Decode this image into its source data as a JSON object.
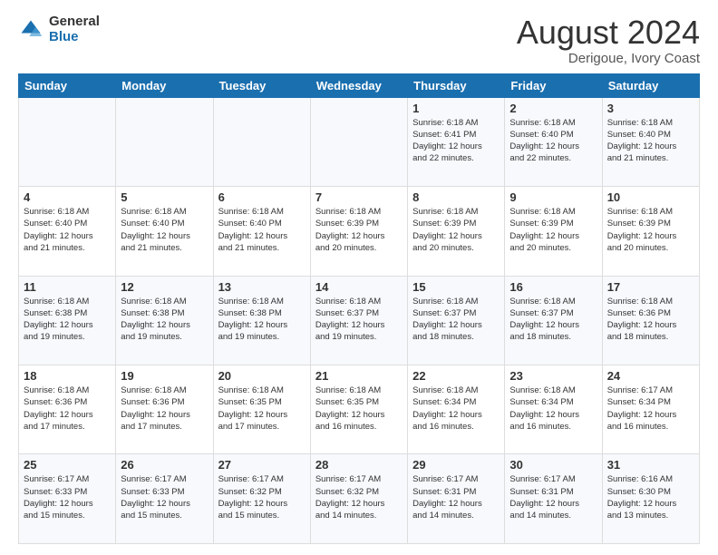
{
  "logo": {
    "general": "General",
    "blue": "Blue"
  },
  "header": {
    "title": "August 2024",
    "subtitle": "Derigoue, Ivory Coast"
  },
  "weekdays": [
    "Sunday",
    "Monday",
    "Tuesday",
    "Wednesday",
    "Thursday",
    "Friday",
    "Saturday"
  ],
  "weeks": [
    [
      {
        "day": "",
        "detail": ""
      },
      {
        "day": "",
        "detail": ""
      },
      {
        "day": "",
        "detail": ""
      },
      {
        "day": "",
        "detail": ""
      },
      {
        "day": "1",
        "detail": "Sunrise: 6:18 AM\nSunset: 6:41 PM\nDaylight: 12 hours\nand 22 minutes."
      },
      {
        "day": "2",
        "detail": "Sunrise: 6:18 AM\nSunset: 6:40 PM\nDaylight: 12 hours\nand 22 minutes."
      },
      {
        "day": "3",
        "detail": "Sunrise: 6:18 AM\nSunset: 6:40 PM\nDaylight: 12 hours\nand 21 minutes."
      }
    ],
    [
      {
        "day": "4",
        "detail": "Sunrise: 6:18 AM\nSunset: 6:40 PM\nDaylight: 12 hours\nand 21 minutes."
      },
      {
        "day": "5",
        "detail": "Sunrise: 6:18 AM\nSunset: 6:40 PM\nDaylight: 12 hours\nand 21 minutes."
      },
      {
        "day": "6",
        "detail": "Sunrise: 6:18 AM\nSunset: 6:40 PM\nDaylight: 12 hours\nand 21 minutes."
      },
      {
        "day": "7",
        "detail": "Sunrise: 6:18 AM\nSunset: 6:39 PM\nDaylight: 12 hours\nand 20 minutes."
      },
      {
        "day": "8",
        "detail": "Sunrise: 6:18 AM\nSunset: 6:39 PM\nDaylight: 12 hours\nand 20 minutes."
      },
      {
        "day": "9",
        "detail": "Sunrise: 6:18 AM\nSunset: 6:39 PM\nDaylight: 12 hours\nand 20 minutes."
      },
      {
        "day": "10",
        "detail": "Sunrise: 6:18 AM\nSunset: 6:39 PM\nDaylight: 12 hours\nand 20 minutes."
      }
    ],
    [
      {
        "day": "11",
        "detail": "Sunrise: 6:18 AM\nSunset: 6:38 PM\nDaylight: 12 hours\nand 19 minutes."
      },
      {
        "day": "12",
        "detail": "Sunrise: 6:18 AM\nSunset: 6:38 PM\nDaylight: 12 hours\nand 19 minutes."
      },
      {
        "day": "13",
        "detail": "Sunrise: 6:18 AM\nSunset: 6:38 PM\nDaylight: 12 hours\nand 19 minutes."
      },
      {
        "day": "14",
        "detail": "Sunrise: 6:18 AM\nSunset: 6:37 PM\nDaylight: 12 hours\nand 19 minutes."
      },
      {
        "day": "15",
        "detail": "Sunrise: 6:18 AM\nSunset: 6:37 PM\nDaylight: 12 hours\nand 18 minutes."
      },
      {
        "day": "16",
        "detail": "Sunrise: 6:18 AM\nSunset: 6:37 PM\nDaylight: 12 hours\nand 18 minutes."
      },
      {
        "day": "17",
        "detail": "Sunrise: 6:18 AM\nSunset: 6:36 PM\nDaylight: 12 hours\nand 18 minutes."
      }
    ],
    [
      {
        "day": "18",
        "detail": "Sunrise: 6:18 AM\nSunset: 6:36 PM\nDaylight: 12 hours\nand 17 minutes."
      },
      {
        "day": "19",
        "detail": "Sunrise: 6:18 AM\nSunset: 6:36 PM\nDaylight: 12 hours\nand 17 minutes."
      },
      {
        "day": "20",
        "detail": "Sunrise: 6:18 AM\nSunset: 6:35 PM\nDaylight: 12 hours\nand 17 minutes."
      },
      {
        "day": "21",
        "detail": "Sunrise: 6:18 AM\nSunset: 6:35 PM\nDaylight: 12 hours\nand 16 minutes."
      },
      {
        "day": "22",
        "detail": "Sunrise: 6:18 AM\nSunset: 6:34 PM\nDaylight: 12 hours\nand 16 minutes."
      },
      {
        "day": "23",
        "detail": "Sunrise: 6:18 AM\nSunset: 6:34 PM\nDaylight: 12 hours\nand 16 minutes."
      },
      {
        "day": "24",
        "detail": "Sunrise: 6:17 AM\nSunset: 6:34 PM\nDaylight: 12 hours\nand 16 minutes."
      }
    ],
    [
      {
        "day": "25",
        "detail": "Sunrise: 6:17 AM\nSunset: 6:33 PM\nDaylight: 12 hours\nand 15 minutes."
      },
      {
        "day": "26",
        "detail": "Sunrise: 6:17 AM\nSunset: 6:33 PM\nDaylight: 12 hours\nand 15 minutes."
      },
      {
        "day": "27",
        "detail": "Sunrise: 6:17 AM\nSunset: 6:32 PM\nDaylight: 12 hours\nand 15 minutes."
      },
      {
        "day": "28",
        "detail": "Sunrise: 6:17 AM\nSunset: 6:32 PM\nDaylight: 12 hours\nand 14 minutes."
      },
      {
        "day": "29",
        "detail": "Sunrise: 6:17 AM\nSunset: 6:31 PM\nDaylight: 12 hours\nand 14 minutes."
      },
      {
        "day": "30",
        "detail": "Sunrise: 6:17 AM\nSunset: 6:31 PM\nDaylight: 12 hours\nand 14 minutes."
      },
      {
        "day": "31",
        "detail": "Sunrise: 6:16 AM\nSunset: 6:30 PM\nDaylight: 12 hours\nand 13 minutes."
      }
    ]
  ]
}
